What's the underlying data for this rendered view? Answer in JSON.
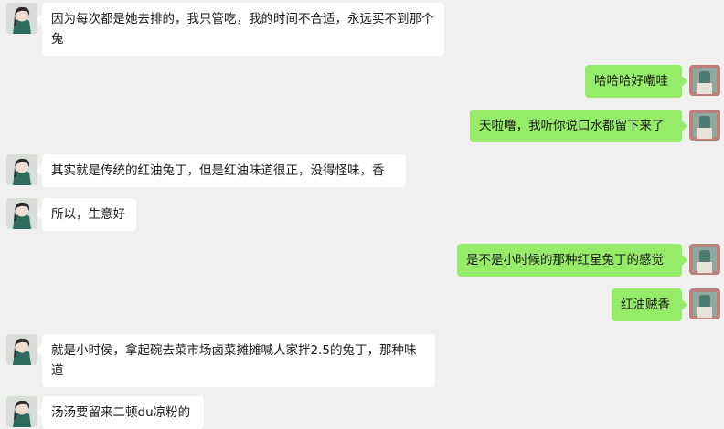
{
  "messages": [
    {
      "side": "in",
      "text": "因为每次都是她去排的，我只管吃，我的时间不合适，永远买不到那个兔"
    },
    {
      "side": "out",
      "text": "哈哈哈好嘞哇"
    },
    {
      "side": "out",
      "text": "天啦噜，我听你说口水都留下来了"
    },
    {
      "side": "in",
      "text": "其实就是传统的红油兔丁，但是红油味道很正，没得怪味，香"
    },
    {
      "side": "in",
      "text": "所以，生意好"
    },
    {
      "side": "out",
      "text": "是不是小时候的那种红星兔丁的感觉"
    },
    {
      "side": "out",
      "text": "红油贼香"
    },
    {
      "side": "in",
      "text": "就是小时侯，拿起碗去菜市场卤菜摊摊喊人家拌2.5的兔丁，那种味道"
    },
    {
      "side": "in",
      "text": "汤汤要留来二顿du凉粉的"
    }
  ],
  "colors": {
    "background": "#f0f0f0",
    "incoming_bubble": "#ffffff",
    "outgoing_bubble": "#95ec69"
  }
}
